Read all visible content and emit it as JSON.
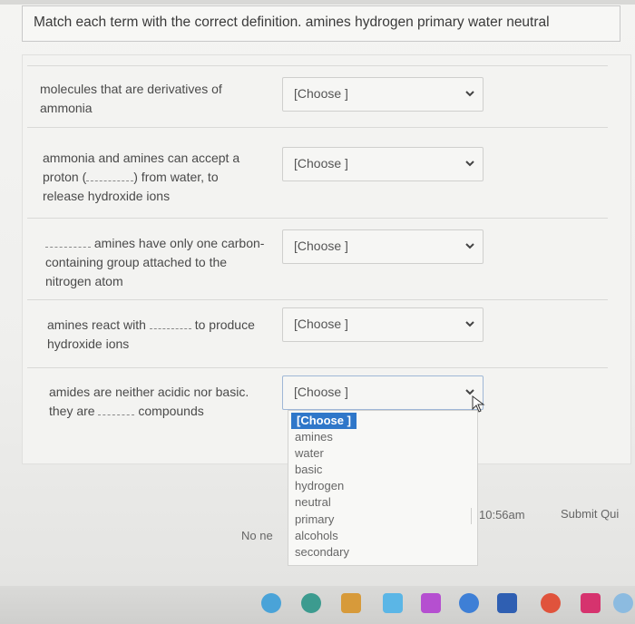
{
  "question": {
    "text": "Match each term with the correct definition. amines hydrogen primary water neutral"
  },
  "items": [
    {
      "lines": [
        "molecules that are derivatives of",
        "ammonia"
      ],
      "select_value": "[Choose ]"
    },
    {
      "lines": [
        "ammonia and amines can accept a",
        "proton (",
        ") from water, to",
        "release hydroxide ions"
      ],
      "select_value": "[Choose ]"
    },
    {
      "lines": [
        "amines have only one carbon-",
        "containing group attached to the",
        "nitrogen atom"
      ],
      "select_value": "[Choose ]"
    },
    {
      "lines": [
        "amines react with",
        "to produce",
        "hydroxide ions"
      ],
      "select_value": "[Choose ]"
    },
    {
      "lines": [
        "amides are neither acidic nor basic.",
        "they are",
        "compounds"
      ],
      "select_value": "[Choose ]"
    }
  ],
  "dropdown": {
    "options": [
      "[Choose ]",
      "amines",
      "water",
      "basic",
      "hydrogen",
      "neutral",
      "primary",
      "alcohols",
      "secondary"
    ]
  },
  "footer": {
    "no_new": "No ne",
    "time": "10:56am",
    "submit": "Submit Qui"
  },
  "colors": {
    "selected_option_bg": "#2f77c9"
  },
  "icons": [
    "chevron-down-icon",
    "mouse-cursor-icon",
    "taskbar-app-icons"
  ]
}
